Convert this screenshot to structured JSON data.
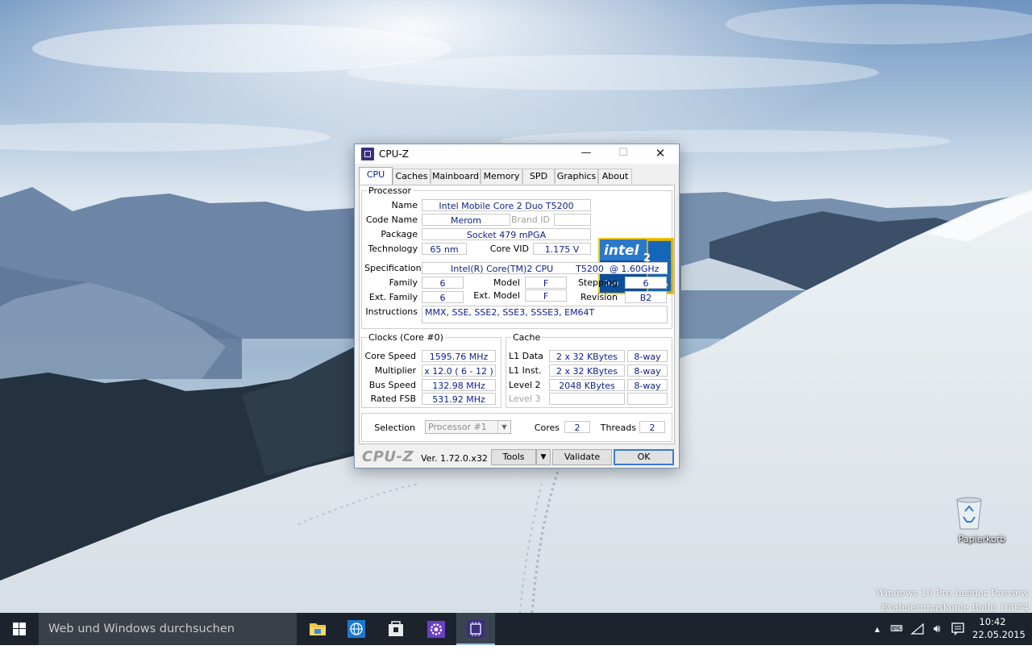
{
  "desktop": {
    "recycle_bin_label": "Papierkorb",
    "watermark_line1": "Windows 10 Pro Insider Preview",
    "watermark_line2": "Evaluierungskopie Build 10074"
  },
  "window": {
    "title": "CPU-Z",
    "minimize": "—",
    "maximize": "☐",
    "close": "✕",
    "tabs": [
      "CPU",
      "Caches",
      "Mainboard",
      "Memory",
      "SPD",
      "Graphics",
      "About"
    ],
    "active_tab": "CPU"
  },
  "processor": {
    "legend": "Processor",
    "name_label": "Name",
    "name": "Intel Mobile Core 2 Duo T5200",
    "code_name_label": "Code Name",
    "code_name": "Merom",
    "brand_id_label": "Brand ID",
    "brand_id": "",
    "package_label": "Package",
    "package": "Socket 479 mPGA",
    "technology_label": "Technology",
    "technology": "65 nm",
    "core_vid_label": "Core VID",
    "core_vid": "1.175 V",
    "specification_label": "Specification",
    "specification": "Intel(R) Core(TM)2 CPU        T5200  @ 1.60GHz",
    "family_label": "Family",
    "family": "6",
    "model_label": "Model",
    "model": "F",
    "stepping_label": "Stepping",
    "stepping": "6",
    "ext_family_label": "Ext. Family",
    "ext_family": "6",
    "ext_model_label": "Ext. Model",
    "ext_model": "F",
    "revision_label": "Revision",
    "revision": "B2",
    "instructions_label": "Instructions",
    "instructions": "MMX, SSE, SSE2, SSE3, SSSE3, EM64T",
    "logo": {
      "line1": "intel",
      "line2": "CORE",
      "sup": "2",
      "line3": "Duo",
      "line4": "inside"
    }
  },
  "clocks": {
    "legend": "Clocks (Core #0)",
    "core_speed_label": "Core Speed",
    "core_speed": "1595.76 MHz",
    "multiplier_label": "Multiplier",
    "multiplier": "x 12.0 ( 6 - 12 )",
    "bus_speed_label": "Bus Speed",
    "bus_speed": "132.98 MHz",
    "rated_fsb_label": "Rated FSB",
    "rated_fsb": "531.92 MHz"
  },
  "cache": {
    "legend": "Cache",
    "l1_data_label": "L1 Data",
    "l1_data": "2 x 32 KBytes",
    "l1_data_way": "8-way",
    "l1_inst_label": "L1 Inst.",
    "l1_inst": "2 x 32 KBytes",
    "l1_inst_way": "8-way",
    "level2_label": "Level 2",
    "level2": "2048 KBytes",
    "level2_way": "8-way",
    "level3_label": "Level 3",
    "level3": "",
    "level3_way": ""
  },
  "selection": {
    "label": "Selection",
    "value": "Processor #1",
    "cores_label": "Cores",
    "cores": "2",
    "threads_label": "Threads",
    "threads": "2"
  },
  "footer": {
    "brand": "CPU-Z",
    "version": "Ver. 1.72.0.x32",
    "tools": "Tools",
    "validate": "Validate",
    "ok": "OK"
  },
  "taskbar": {
    "search_placeholder": "Web und Windows durchsuchen",
    "time": "10:42",
    "date": "22.05.2015"
  },
  "colors": {
    "taskbar": "#1c232d",
    "value_text": "#0b1f8a",
    "tab_active": "#0a2a8e"
  }
}
